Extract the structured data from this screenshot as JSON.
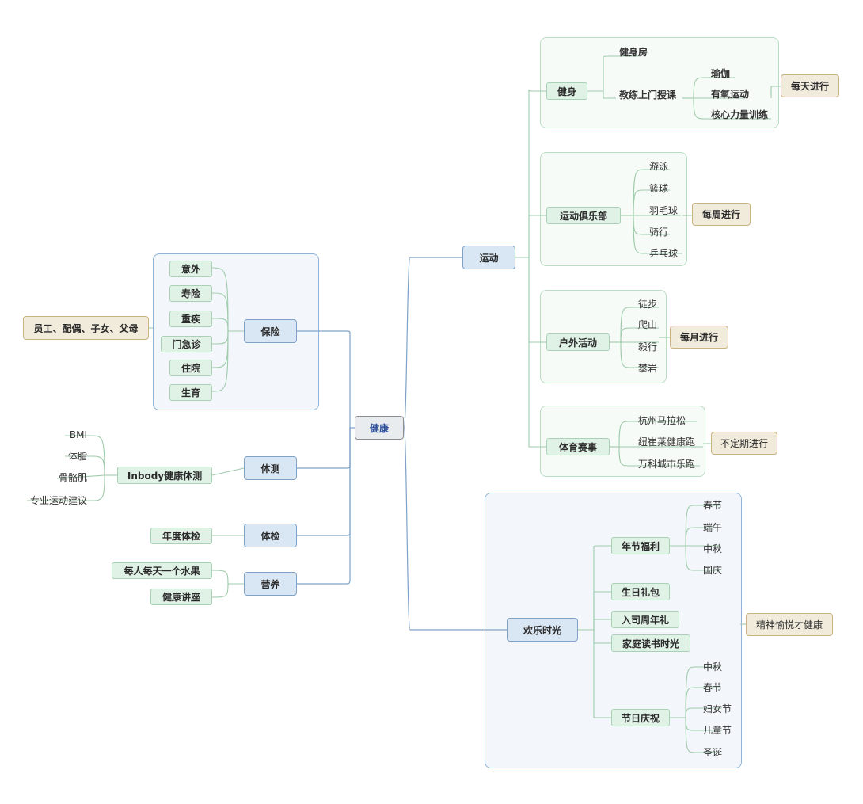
{
  "center": "健康",
  "insurance": {
    "label": "保险",
    "items": [
      "意外",
      "寿险",
      "重疾",
      "门急诊",
      "住院",
      "生育"
    ],
    "tag": "员工、配偶、子女、父母"
  },
  "body_test": {
    "label": "体测",
    "item": "Inbody健康体测",
    "leaves": [
      "BMI",
      "体脂",
      "骨骼肌",
      "专业运动建议"
    ]
  },
  "checkup": {
    "label": "体检",
    "item": "年度体检"
  },
  "nutrition": {
    "label": "营养",
    "items": [
      "每人每天一个水果",
      "健康讲座"
    ]
  },
  "sports": {
    "label": "运动",
    "fitness": {
      "label": "健身",
      "gym": "健身房",
      "coach": "教练上门授课",
      "coach_items": [
        "瑜伽",
        "有氧运动",
        "核心力量训练"
      ],
      "tag": "每天进行"
    },
    "club": {
      "label": "运动俱乐部",
      "items": [
        "游泳",
        "篮球",
        "羽毛球",
        "骑行",
        "乒乓球"
      ],
      "tag": "每周进行"
    },
    "outdoor": {
      "label": "户外活动",
      "items": [
        "徒步",
        "爬山",
        "毅行",
        "攀岩"
      ],
      "tag": "每月进行"
    },
    "events": {
      "label": "体育赛事",
      "items": [
        "杭州马拉松",
        "纽崔莱健康跑",
        "万科城市乐跑"
      ],
      "tag": "不定期进行"
    }
  },
  "fun": {
    "label": "欢乐时光",
    "festival_welfare": {
      "label": "年节福利",
      "items": [
        "春节",
        "端午",
        "中秋",
        "国庆"
      ]
    },
    "birthday": "生日礼包",
    "anniversary": "入司周年礼",
    "family_reading": "家庭读书时光",
    "celebration": {
      "label": "节日庆祝",
      "items": [
        "中秋",
        "春节",
        "妇女节",
        "儿童节",
        "圣诞"
      ]
    },
    "tag": "精神愉悦才健康"
  }
}
